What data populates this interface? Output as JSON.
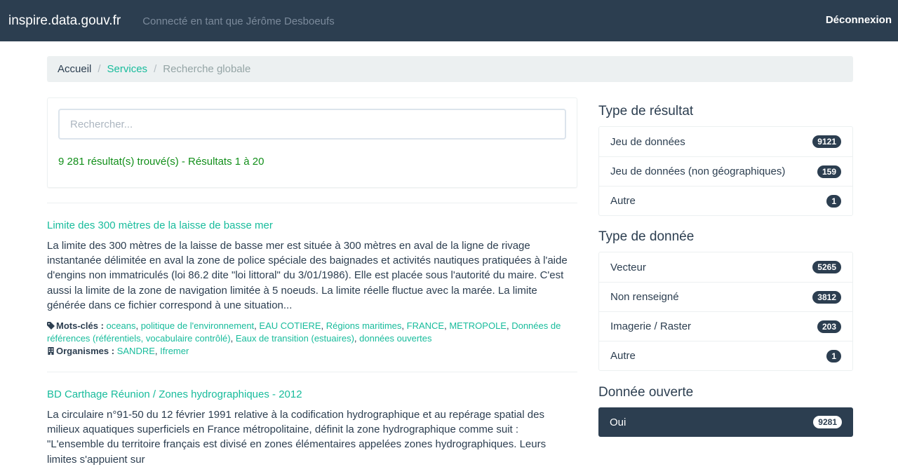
{
  "navbar": {
    "brand": "inspire.data.gouv.fr",
    "user_text": "Connecté en tant que Jérôme Desboeufs",
    "logout": "Déconnexion",
    "bg_color": "#2c3e50"
  },
  "breadcrumb": {
    "home": "Accueil",
    "services": "Services",
    "current": "Recherche globale",
    "separator": "/"
  },
  "search": {
    "placeholder": "Rechercher...",
    "result_count": "9 281 résultat(s) trouvé(s) - Résultats 1 à 20"
  },
  "results": [
    {
      "title": "Limite des 300 mètres de la laisse de basse mer",
      "description": "La limite des 300 mètres de la laisse de basse mer est située à 300 mètres en aval de la ligne de rivage instantanée délimitée en aval la zone de police spéciale des baignades et activités nautiques pratiquées à l'aide d'engins non immatriculés (loi 86.2 dite \"loi littoral\" du 3/01/1986). Elle est placée sous l'autorité du maire. C'est aussi la limite de la zone de navigation limitée à 5 noeuds. La limite réelle fluctue avec la marée. La limite générée dans ce fichier correspond à une situation...",
      "keywords_label": "Mots-clés :",
      "keywords": [
        "oceans",
        "politique de l'environnement",
        "EAU COTIERE",
        "Régions maritimes",
        "FRANCE",
        "METROPOLE",
        "Données de références (référentiels, vocabulaire contrôlé)",
        "Eaux de transition (estuaires)",
        "données ouvertes"
      ],
      "organisms_label": "Organismes :",
      "organisms": [
        "SANDRE",
        "Ifremer"
      ]
    },
    {
      "title": "BD Carthage Réunion / Zones hydrographiques - 2012",
      "description": "La circulaire n°91-50 du 12 février 1991 relative à la codification hydrographique et au repérage spatial des milieux aquatiques superficiels en France métropolitaine, définit la zone hydrographique comme suit : \"L'ensemble du territoire français est divisé en zones élémentaires appelées zones hydrographiques. Leurs limites s'appuient sur"
    }
  ],
  "facets": {
    "result_type": {
      "title": "Type de résultat",
      "items": [
        {
          "label": "Jeu de données",
          "count": "9121"
        },
        {
          "label": "Jeu de données (non géographiques)",
          "count": "159"
        },
        {
          "label": "Autre",
          "count": "1"
        }
      ]
    },
    "data_type": {
      "title": "Type de donnée",
      "items": [
        {
          "label": "Vecteur",
          "count": "5265"
        },
        {
          "label": "Non renseigné",
          "count": "3812"
        },
        {
          "label": "Imagerie / Raster",
          "count": "203"
        },
        {
          "label": "Autre",
          "count": "1"
        }
      ]
    },
    "open_data": {
      "title": "Donnée ouverte",
      "items": [
        {
          "label": "Oui",
          "count": "9281",
          "active": true
        }
      ]
    }
  },
  "colors": {
    "accent": "#18bc9c",
    "primary": "#2c3e50",
    "success_text": "#128f1a",
    "muted": "#95a5a6"
  }
}
